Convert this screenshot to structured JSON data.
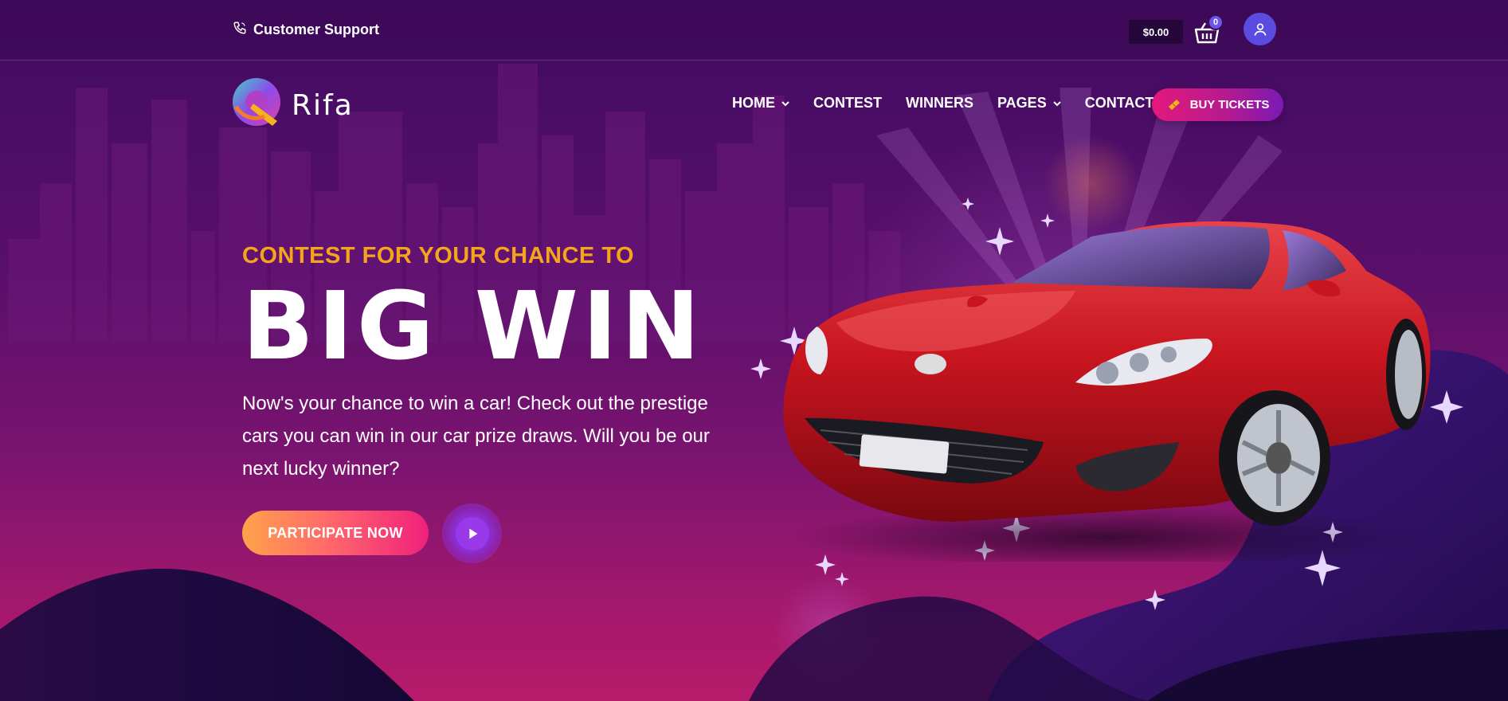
{
  "topbar": {
    "support_label": "Customer Support",
    "cart_total": "$0.00",
    "cart_count": "0",
    "icons": [
      "phone-icon",
      "basket-icon",
      "user-icon"
    ]
  },
  "brand": {
    "name": "Rifa"
  },
  "nav": {
    "items": [
      {
        "label": "HOME",
        "has_dropdown": true
      },
      {
        "label": "CONTEST",
        "has_dropdown": false
      },
      {
        "label": "WINNERS",
        "has_dropdown": false
      },
      {
        "label": "PAGES",
        "has_dropdown": true
      },
      {
        "label": "CONTACT",
        "has_dropdown": false
      }
    ],
    "cta_label": "BUY TICKETS",
    "cta_icon": "ticket-icon"
  },
  "hero": {
    "subtitle": "CONTEST FOR YOUR CHANCE TO",
    "title": "BIG WIN",
    "description": "Now's your chance to win a car! Check out the prestige cars you can win in our car prize draws. Will you be our next lucky winner?",
    "primary_button": "PARTICIPATE NOW",
    "play_icon": "play-icon",
    "image": "red-sports-car"
  },
  "colors": {
    "background_top": "#3d0a5a",
    "background_bottom": "#b81a6a",
    "accent_orange": "#f5a51c",
    "cta_pink": "#e3197c",
    "cta_purple": "#7a1ab4",
    "user_button": "#5b4ce0",
    "car_red": "#c81c24"
  }
}
